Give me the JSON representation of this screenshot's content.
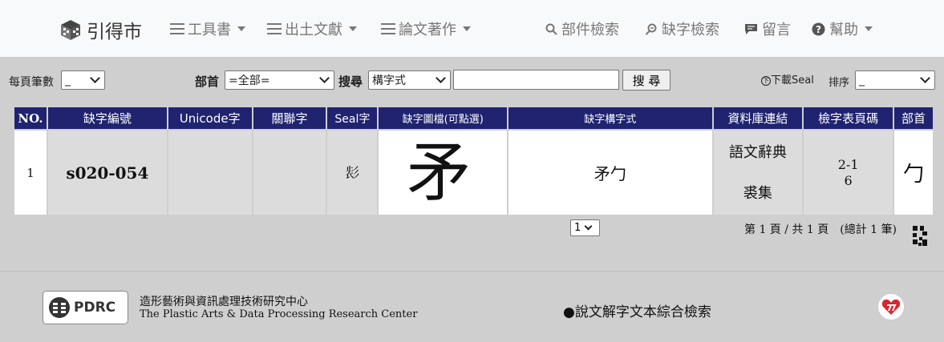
{
  "nav": {
    "brand": "引得市",
    "items": [
      {
        "label": "工具書"
      },
      {
        "label": "出土文獻"
      },
      {
        "label": "論文著作"
      }
    ],
    "right": [
      {
        "label": "部件檢索"
      },
      {
        "label": "缺字檢索"
      },
      {
        "label": "留言"
      },
      {
        "label": "幫助"
      }
    ]
  },
  "search": {
    "per_page_label": "每頁筆數",
    "per_page_value": "_",
    "radical_label": "部首",
    "radical_value": "=全部=",
    "search_label": "搜尋",
    "search_type_value": "構字式",
    "search_input_value": "",
    "search_button": "搜 尋",
    "download_label": "下載Seal",
    "sort_label": "排序",
    "sort_value": "_"
  },
  "table": {
    "headers": [
      "NO.",
      "缺字編號",
      "Unicode字",
      "關聯字",
      "Seal字",
      "缺字圖檔(可點選)",
      "缺字構字式",
      "資料庫連結",
      "檢字表頁碼",
      "部首"
    ],
    "rows": [
      {
        "no": "1",
        "code": "s020-054",
        "unicode": "",
        "related": "",
        "seal": "𢒕",
        "image_glyph": "矛",
        "composition": "矛勹",
        "db_links": [
          "語文辭典",
          "裘集"
        ],
        "page": "2-1\n6",
        "page_line1": "2-1",
        "page_line2": "6",
        "radical": "勹"
      }
    ]
  },
  "pagination": {
    "page_select": "1",
    "info": "第 1 頁 / 共 1 頁　(總計 1 筆)"
  },
  "footer": {
    "logo_text": "PDRC",
    "org_zh": "造形藝術與資訊處理技術研究中心",
    "org_en": "The Plastic Arts & Data Processing Research Center",
    "link": "●說文解字文本綜合檢索"
  },
  "colors": {
    "header_bg": "#1f2370",
    "nav_bg": "#f8f9fa",
    "page_bg": "#cfcfcf",
    "cell_grey": "#dcdcdc"
  }
}
